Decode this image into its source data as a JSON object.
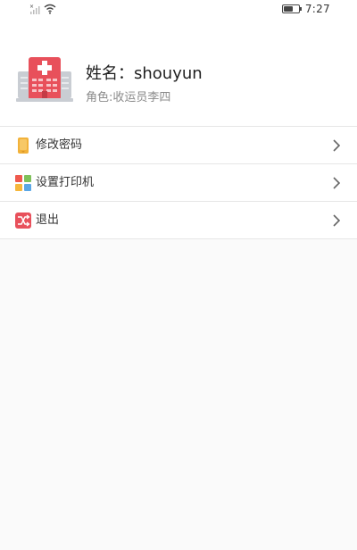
{
  "status_bar": {
    "time": "7:27",
    "battery_level": 0.6,
    "icons": [
      "signal-icon",
      "wifi-icon",
      "battery-icon"
    ]
  },
  "profile": {
    "name": "姓名：shouyun",
    "role": "角色:收运员李四",
    "avatar_icon": "hospital-icon"
  },
  "menu": {
    "items": [
      {
        "label": "修改密码",
        "icon": "phone-icon"
      },
      {
        "label": "设置打印机",
        "icon": "grid-icon"
      },
      {
        "label": "退出",
        "icon": "shuffle-icon"
      }
    ]
  },
  "colors": {
    "hospital_red": "#e8505b",
    "hospital_gray": "#c9cdd3",
    "phone_orange": "#f2b23a",
    "exit_red": "#e8505b",
    "grid_red": "#ef5a4e",
    "grid_green": "#7fc15a",
    "grid_yellow": "#f6b73c",
    "grid_blue": "#5aa7e6"
  }
}
